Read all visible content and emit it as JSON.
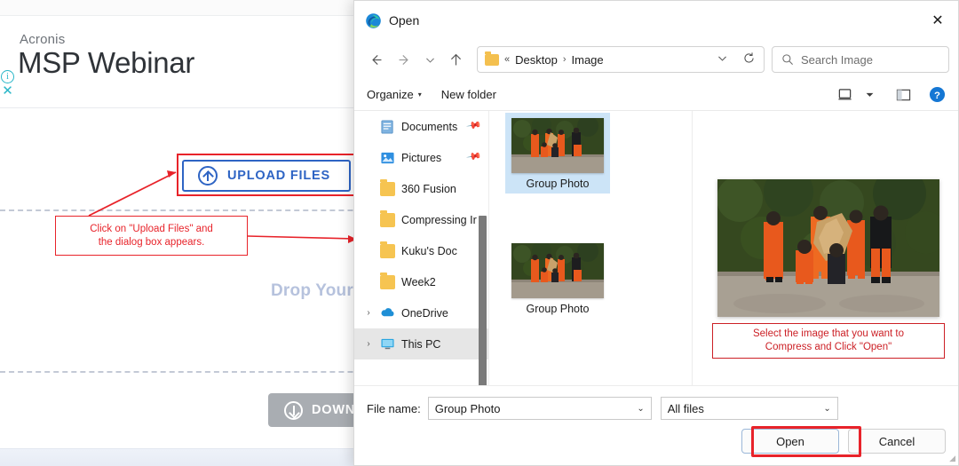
{
  "webpage": {
    "brand": "Acronis",
    "title": "MSP Webinar",
    "info_icon": "info-circle-icon",
    "close_icon": "close-x-icon",
    "upload_button": "UPLOAD FILES",
    "upload_icon": "upload-arrow-circle-icon",
    "drop_text": "Drop Your",
    "download_button": "DOWN",
    "download_icon": "download-arrow-circle-icon"
  },
  "annotations": {
    "upload_callout": "Click on \"Upload Files\" and the dialog box appears.",
    "upload_callout_line1": "Click on \"Upload Files\" and",
    "upload_callout_line2": "the dialog box appears.",
    "select_callout_line1": "Select the image that you want to",
    "select_callout_line2": "Compress and Click \"Open\"",
    "accent_color": "#e8232a",
    "select_accent_color": "#cc2026"
  },
  "dialog": {
    "title": "Open",
    "app_icon": "edge-browser-icon",
    "close_icon": "close-icon",
    "nav": {
      "back_icon": "arrow-left-icon",
      "forward_icon": "arrow-right-icon",
      "recent_icon": "chevron-down-icon",
      "up_icon": "arrow-up-icon",
      "folder_icon": "folder-icon",
      "path_prefix": "«",
      "breadcrumb": [
        "Desktop",
        "Image"
      ],
      "breadcrumb_separator": "›",
      "address_dropdown_icon": "chevron-down-icon",
      "refresh_icon": "refresh-icon"
    },
    "search": {
      "icon": "search-icon",
      "placeholder": "Search Image"
    },
    "toolbar": {
      "organize": "Organize",
      "organize_caret": "▾",
      "new_folder": "New folder",
      "view_icon": "view-options-icon",
      "view_caret": "▾",
      "preview_pane_icon": "preview-pane-icon",
      "help_icon": "help-question-icon"
    },
    "sidebar": {
      "items": [
        {
          "label": "Documents",
          "icon": "documents-icon",
          "pinned": true,
          "expandable": false,
          "selected": false
        },
        {
          "label": "Pictures",
          "icon": "pictures-icon",
          "pinned": true,
          "expandable": false,
          "selected": false
        },
        {
          "label": "360 Fusion",
          "icon": "folder-icon",
          "pinned": false,
          "expandable": false,
          "selected": false
        },
        {
          "label": "Compressing Ir",
          "icon": "folder-icon",
          "pinned": false,
          "expandable": false,
          "selected": false
        },
        {
          "label": "Kuku's Doc",
          "icon": "folder-icon",
          "pinned": false,
          "expandable": false,
          "selected": false
        },
        {
          "label": "Week2",
          "icon": "folder-icon",
          "pinned": false,
          "expandable": false,
          "selected": false
        },
        {
          "label": "OneDrive",
          "icon": "onedrive-cloud-icon",
          "pinned": false,
          "expandable": true,
          "selected": false
        },
        {
          "label": "This PC",
          "icon": "this-pc-monitor-icon",
          "pinned": false,
          "expandable": true,
          "selected": true
        }
      ]
    },
    "files": [
      {
        "name": "Group Photo",
        "selected": true
      },
      {
        "name": "Group Photo",
        "selected": false
      }
    ],
    "preview": {
      "alt": "group-photo-preview"
    },
    "footer": {
      "file_name_label": "File name:",
      "file_name_value": "Group Photo",
      "file_name_caret": "⌄",
      "filter_value": "All files",
      "filter_caret": "⌄",
      "open_button": "Open",
      "cancel_button": "Cancel"
    }
  }
}
